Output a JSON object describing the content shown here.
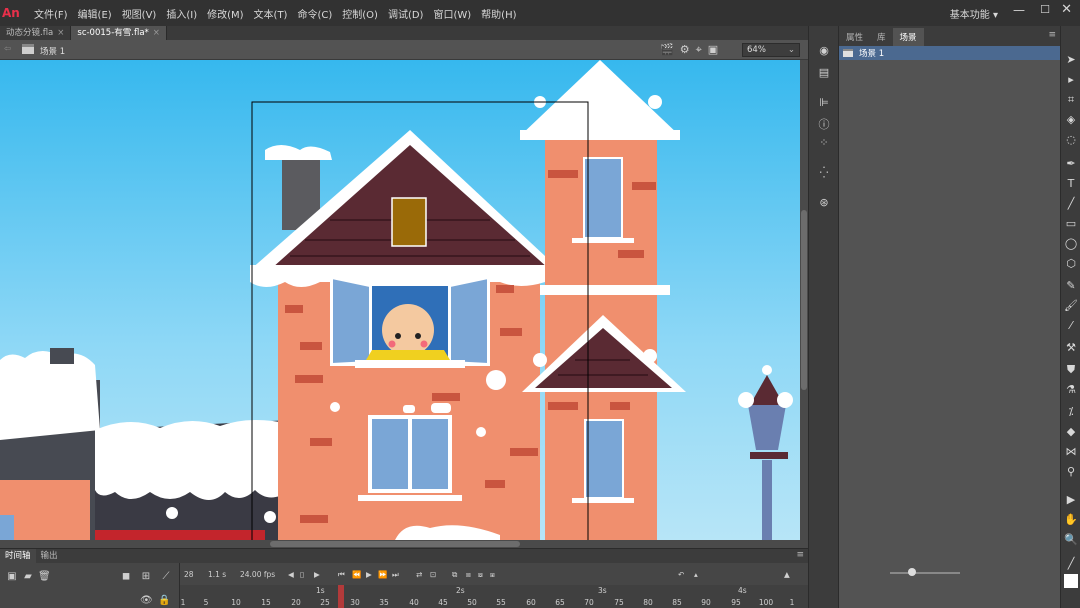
{
  "app": {
    "logo": "An",
    "menu": [
      "文件(F)",
      "编辑(E)",
      "视图(V)",
      "插入(I)",
      "修改(M)",
      "文本(T)",
      "命令(C)",
      "控制(O)",
      "调试(D)",
      "窗口(W)",
      "帮助(H)"
    ],
    "workspace": "基本功能"
  },
  "doc_tabs": [
    {
      "label": "动态分镜.fla",
      "close": "×"
    },
    {
      "label": "sc-0015-有雪.fla*",
      "close": "×"
    }
  ],
  "editbar": {
    "scene": "场景 1",
    "zoom": "64%"
  },
  "right_panel": {
    "tabs": [
      "属性",
      "库",
      "场景"
    ],
    "scene_item": "场景 1"
  },
  "timeline": {
    "tabs": [
      "时间轴",
      "输出"
    ],
    "current_frame": "28",
    "time": "1.1 s",
    "fps": "24.00 fps",
    "seconds": [
      "1s",
      "2s",
      "3s",
      "4s"
    ],
    "frames": [
      "1",
      "5",
      "10",
      "15",
      "20",
      "25",
      "30",
      "35",
      "40",
      "45",
      "50",
      "55",
      "60",
      "65",
      "70",
      "75",
      "80",
      "85",
      "90",
      "95",
      "100",
      "1"
    ]
  },
  "colors": {
    "sky_top": "#36b8ee",
    "brick": "#f08f6e",
    "roof": "#5a2a33",
    "snow": "#ffffff",
    "window": "#7aa6d6"
  }
}
